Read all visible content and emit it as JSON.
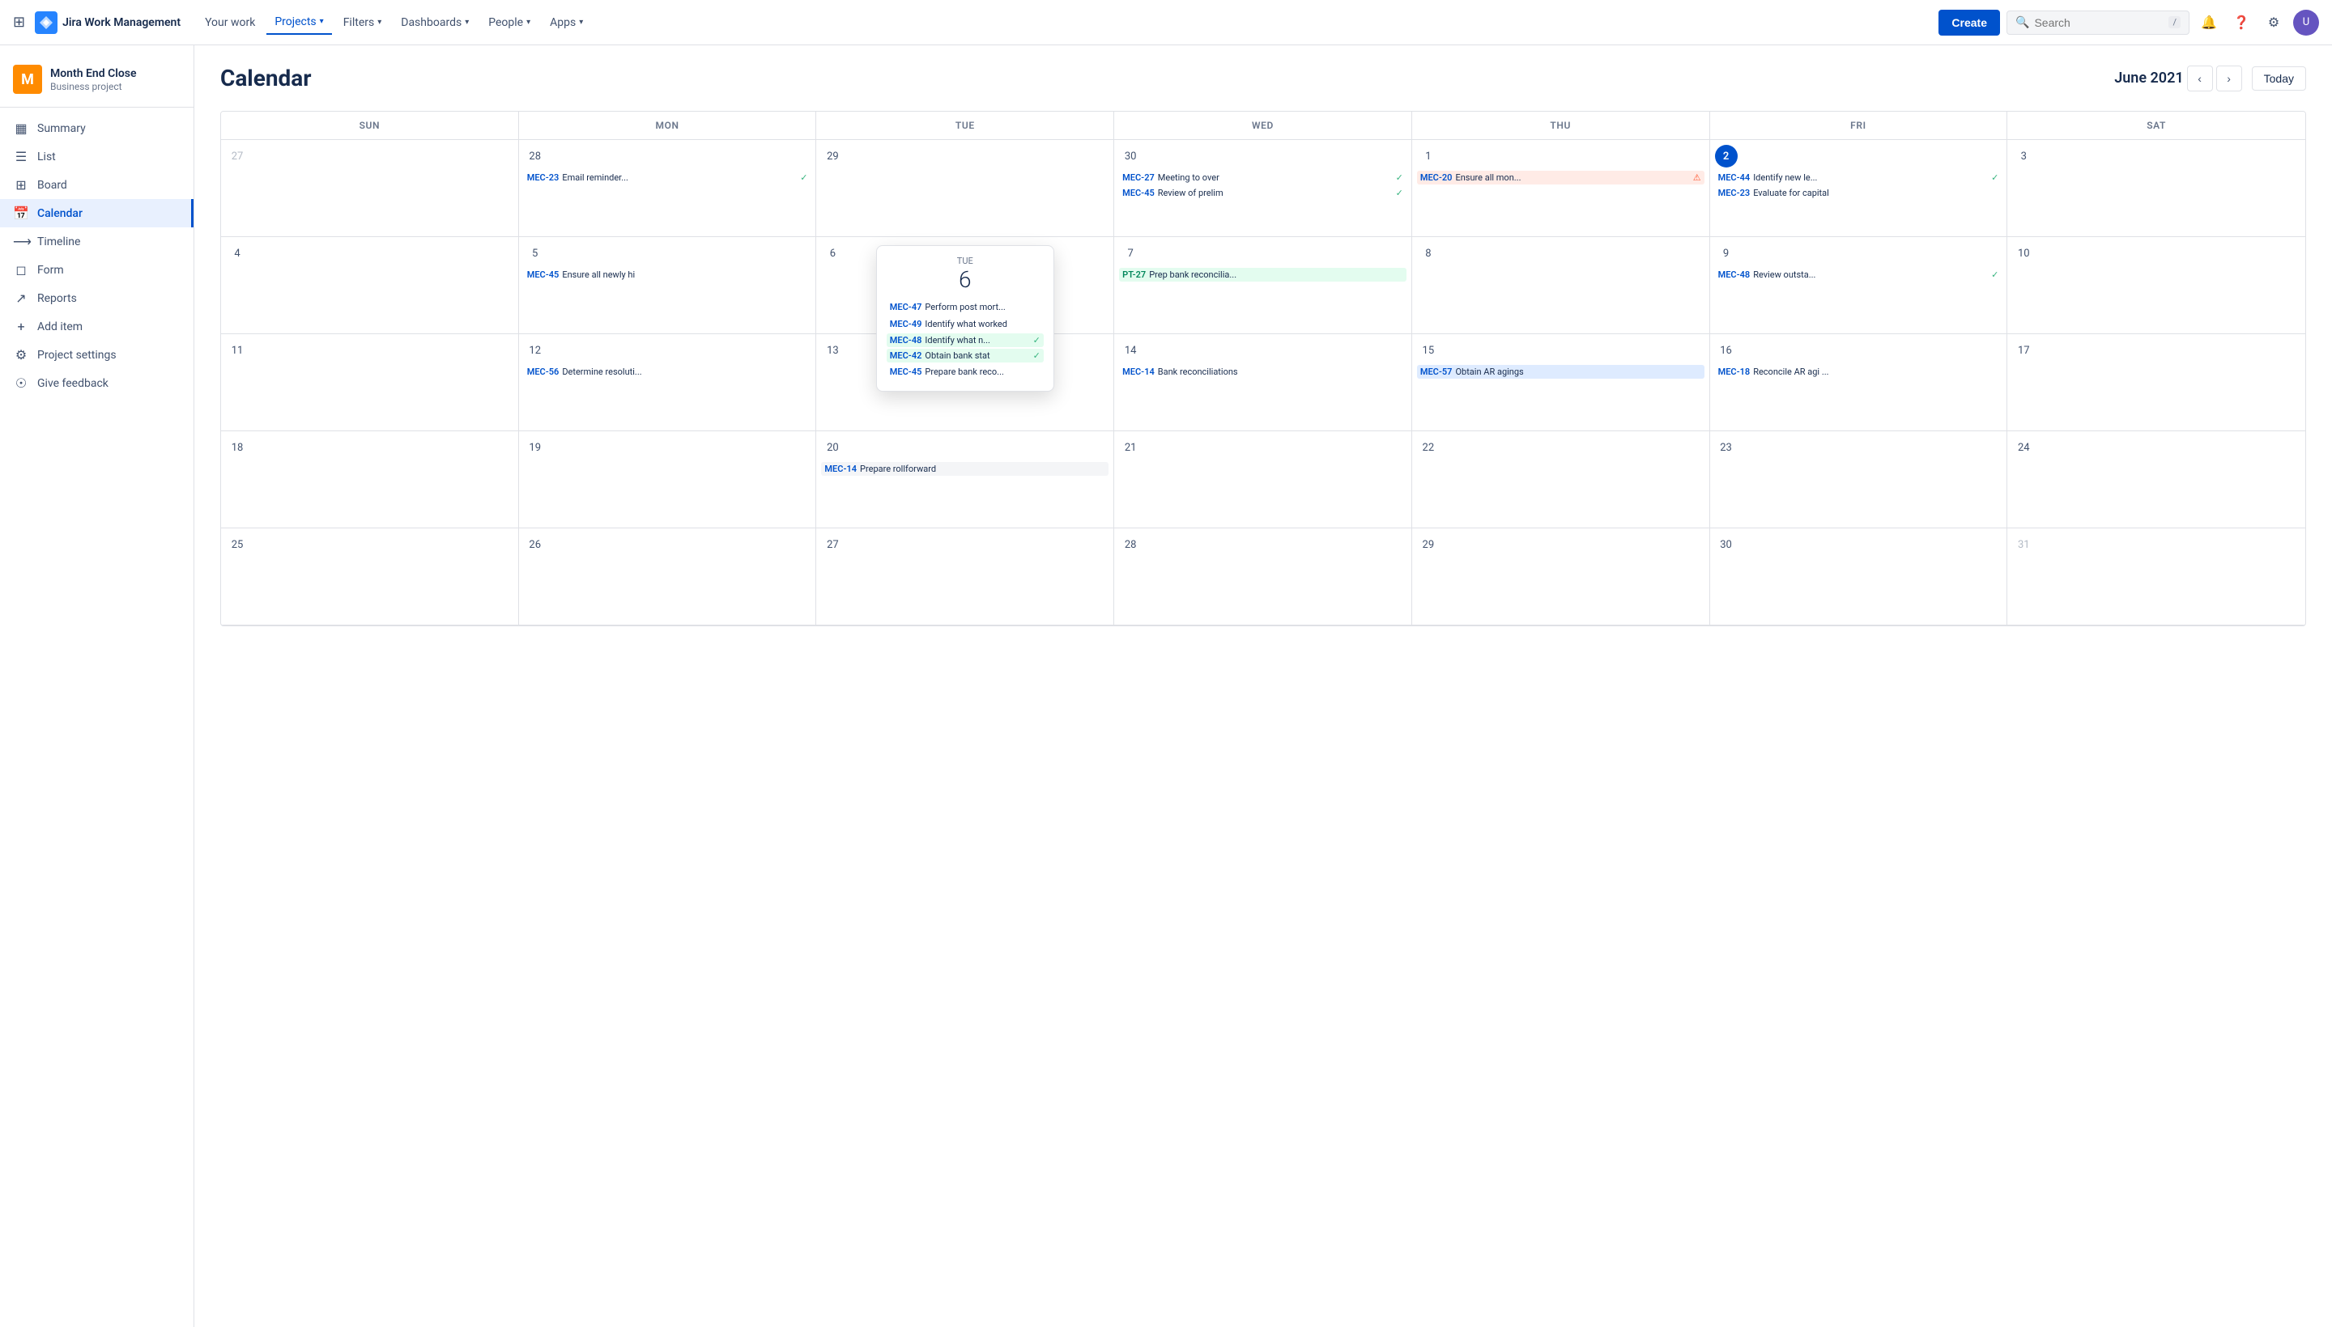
{
  "topnav": {
    "logo_text": "Jira Work Management",
    "nav_items": [
      {
        "label": "Your work",
        "active": false
      },
      {
        "label": "Projects",
        "active": true
      },
      {
        "label": "Filters",
        "active": false
      },
      {
        "label": "Dashboards",
        "active": false
      },
      {
        "label": "People",
        "active": false
      },
      {
        "label": "Apps",
        "active": false
      }
    ],
    "create_label": "Create",
    "search_placeholder": "Search",
    "search_kbd": "/"
  },
  "sidebar": {
    "project_name": "Month End Close",
    "project_type": "Business project",
    "items": [
      {
        "label": "Summary",
        "icon": "▦",
        "active": false
      },
      {
        "label": "List",
        "icon": "☰",
        "active": false
      },
      {
        "label": "Board",
        "icon": "⊞",
        "active": false
      },
      {
        "label": "Calendar",
        "icon": "▦",
        "active": true
      },
      {
        "label": "Timeline",
        "icon": "⟶",
        "active": false
      },
      {
        "label": "Form",
        "icon": "◻",
        "active": false
      },
      {
        "label": "Reports",
        "icon": "↗",
        "active": false
      },
      {
        "label": "Add item",
        "icon": "+",
        "active": false
      },
      {
        "label": "Project settings",
        "icon": "⚙",
        "active": false
      },
      {
        "label": "Give feedback",
        "icon": "☉",
        "active": false
      }
    ]
  },
  "calendar": {
    "title": "Calendar",
    "month_label": "June 2021",
    "today_label": "Today",
    "days_of_week": [
      "SUN",
      "MON",
      "TUE",
      "WED",
      "THU",
      "FRI",
      "SAT"
    ],
    "weeks": [
      {
        "days": [
          {
            "date": "27",
            "other": true,
            "events": []
          },
          {
            "date": "28",
            "other": false,
            "events": [
              {
                "id": "MEC-23",
                "id_class": "mec",
                "title": "Email reminder...",
                "check": true,
                "style": "normal"
              }
            ]
          },
          {
            "date": "29",
            "other": false,
            "events": []
          },
          {
            "date": "30",
            "other": false,
            "events": [
              {
                "id": "MEC-27",
                "id_class": "mec",
                "title": "Meeting to over",
                "check": true,
                "style": "normal"
              },
              {
                "id": "MEC-45",
                "id_class": "mec",
                "title": "Review of prelim",
                "check": true,
                "style": "normal"
              }
            ]
          },
          {
            "date": "1",
            "other": false,
            "events": [
              {
                "id": "MEC-20",
                "id_class": "mec",
                "title": "Ensure all mon...",
                "error": true,
                "style": "red"
              }
            ]
          },
          {
            "date": "2",
            "other": false,
            "today": true,
            "events": [
              {
                "id": "MEC-44",
                "id_class": "mec",
                "title": "Identify new le...",
                "check": true,
                "style": "normal"
              },
              {
                "id": "MEC-23",
                "id_class": "mec",
                "title": "Evaluate for capital",
                "style": "normal"
              }
            ]
          },
          {
            "date": "3",
            "other": false,
            "events": []
          }
        ]
      },
      {
        "days": [
          {
            "date": "4",
            "other": false,
            "events": []
          },
          {
            "date": "5",
            "other": false,
            "events": [
              {
                "id": "MEC-45",
                "id_class": "mec",
                "title": "Ensure all newly hi",
                "style": "normal"
              }
            ]
          },
          {
            "date": "6",
            "other": false,
            "popup": true,
            "events": []
          },
          {
            "date": "7",
            "other": false,
            "events": [
              {
                "id": "PT-27",
                "id_class": "pt",
                "title": "Prep bank reconcilia...",
                "style": "green"
              }
            ]
          },
          {
            "date": "8",
            "other": false,
            "events": []
          },
          {
            "date": "9",
            "other": false,
            "events": [
              {
                "id": "MEC-48",
                "id_class": "mec",
                "title": "Review outsta...",
                "check": true,
                "style": "normal"
              }
            ]
          },
          {
            "date": "10",
            "other": false,
            "events": []
          }
        ]
      },
      {
        "days": [
          {
            "date": "11",
            "other": false,
            "events": []
          },
          {
            "date": "12",
            "other": false,
            "events": [
              {
                "id": "MEC-56",
                "id_class": "mec",
                "title": "Determine resoluti...",
                "style": "normal"
              }
            ]
          },
          {
            "date": "13",
            "other": false,
            "events": []
          },
          {
            "date": "14",
            "other": false,
            "events": [
              {
                "id": "MEC-14",
                "id_class": "mec",
                "title": "Bank reconciliations",
                "style": "normal"
              }
            ]
          },
          {
            "date": "15",
            "other": false,
            "events": [
              {
                "id": "MEC-57",
                "id_class": "mec",
                "title": "Obtain AR agings",
                "style": "blue"
              }
            ]
          },
          {
            "date": "16",
            "other": false,
            "events": [
              {
                "id": "MEC-18",
                "id_class": "mec",
                "title": "Reconcile AR agi ...",
                "style": "normal"
              }
            ]
          },
          {
            "date": "17",
            "other": false,
            "events": []
          }
        ]
      },
      {
        "days": [
          {
            "date": "18",
            "other": false,
            "events": []
          },
          {
            "date": "19",
            "other": false,
            "events": []
          },
          {
            "date": "20",
            "other": false,
            "events": [
              {
                "id": "MEC-14",
                "id_class": "mec",
                "title": "Prepare rollforward",
                "style": "gray"
              }
            ]
          },
          {
            "date": "21",
            "other": false,
            "events": []
          },
          {
            "date": "22",
            "other": false,
            "events": []
          },
          {
            "date": "23",
            "other": false,
            "events": []
          },
          {
            "date": "24",
            "other": false,
            "events": []
          }
        ]
      },
      {
        "days": [
          {
            "date": "25",
            "other": false,
            "events": []
          },
          {
            "date": "26",
            "other": false,
            "events": []
          },
          {
            "date": "27",
            "other": false,
            "events": []
          },
          {
            "date": "28",
            "other": false,
            "events": []
          },
          {
            "date": "29",
            "other": false,
            "events": []
          },
          {
            "date": "30",
            "other": false,
            "events": []
          },
          {
            "date": "31",
            "other": true,
            "events": []
          }
        ]
      }
    ],
    "popup": {
      "day_label": "TUE",
      "day_num": "6",
      "events": [
        {
          "id": "MEC-47",
          "id_class": "mec",
          "title": "Perform post mort...",
          "style": "normal"
        },
        {
          "id": "MEC-49",
          "id_class": "mec",
          "title": "Identify what worked",
          "style": "normal"
        },
        {
          "id": "MEC-48",
          "id_class": "mec",
          "title": "Identify what n...",
          "check": true,
          "style": "green"
        },
        {
          "id": "MEC-42",
          "id_class": "mec",
          "title": "Obtain bank stat",
          "check": true,
          "style": "green"
        },
        {
          "id": "MEC-45",
          "id_class": "mec",
          "title": "Prepare bank reco...",
          "style": "normal"
        }
      ]
    }
  }
}
